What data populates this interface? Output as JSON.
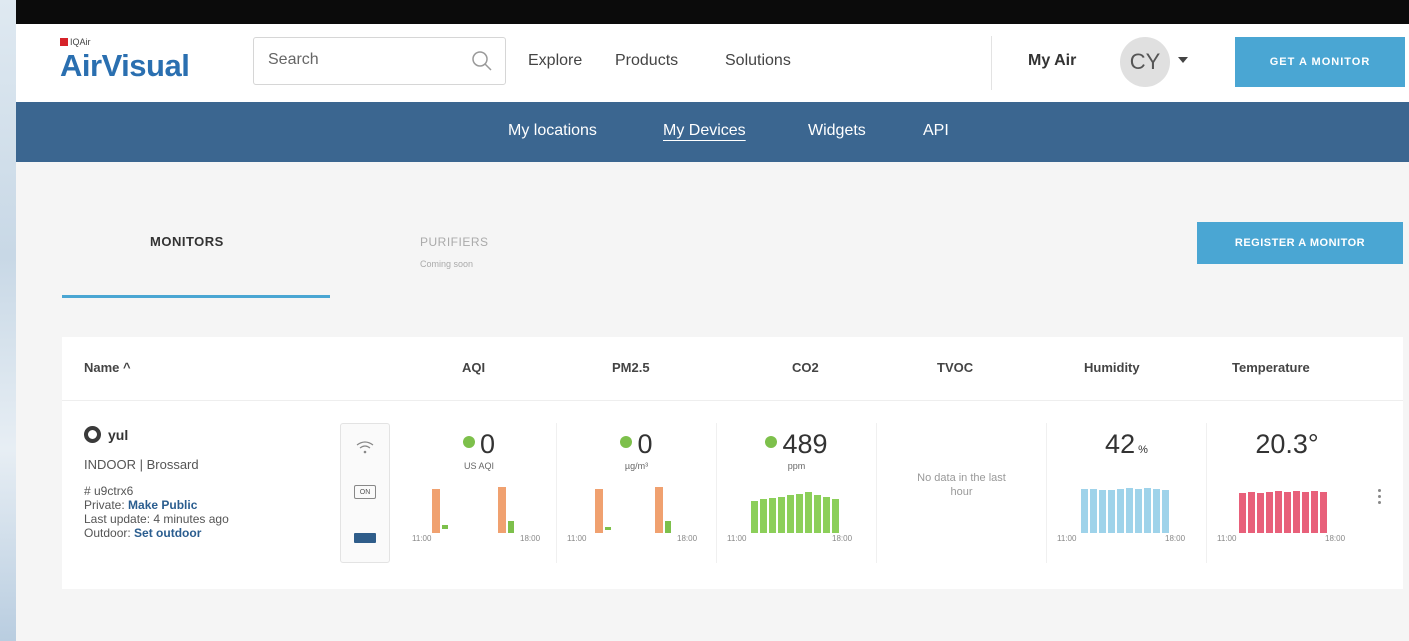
{
  "brand": {
    "small": "IQAir",
    "name": "AirVisual"
  },
  "search": {
    "placeholder": "Search"
  },
  "topnav": {
    "links": [
      "Explore",
      "Products",
      "Solutions"
    ],
    "my_air": "My Air",
    "avatar": "CY",
    "cta": "GET A MONITOR"
  },
  "subnav": {
    "links": [
      "My locations",
      "My Devices",
      "Widgets",
      "API"
    ],
    "active": "My Devices"
  },
  "tabs": {
    "monitors": "MONITORS",
    "purifiers": "PURIFIERS",
    "purifiers_sub": "Coming soon"
  },
  "register_button": "REGISTER A MONITOR",
  "table": {
    "headers": {
      "name": "Name ^",
      "aqi": "AQI",
      "pm25": "PM2.5",
      "co2": "CO2",
      "tvoc": "TVOC",
      "humidity": "Humidity",
      "temperature": "Temperature"
    },
    "device": {
      "name": "yul",
      "location": "INDOOR | Brossard",
      "id": "# u9ctrx6",
      "private_label": "Private:",
      "make_public": "Make Public",
      "last_update": "Last update: 4 minutes ago",
      "outdoor_label": "Outdoor:",
      "set_outdoor": "Set outdoor",
      "on_label": "ON"
    },
    "metrics": {
      "aqi": {
        "value": "0",
        "unit": "US AQI",
        "tick_start": "11:00",
        "tick_end": "18:00"
      },
      "pm25": {
        "value": "0",
        "unit": "µg/m³",
        "tick_start": "11:00",
        "tick_end": "18:00"
      },
      "co2": {
        "value": "489",
        "unit": "ppm",
        "tick_start": "11:00",
        "tick_end": "18:00"
      },
      "tvoc": {
        "nodata": "No data in the last hour"
      },
      "humidity": {
        "value": "42",
        "unit": "%",
        "tick_start": "11:00",
        "tick_end": "18:00"
      },
      "temperature": {
        "value": "20.3°",
        "tick_start": "11:00",
        "tick_end": "18:00"
      }
    }
  },
  "colors": {
    "accent": "#4aa6d3",
    "subnav": "#3b6690",
    "good": "#7dc04b",
    "orange": "#f0a170",
    "humidity": "#9fd3ea",
    "temperature": "#e8607a"
  }
}
